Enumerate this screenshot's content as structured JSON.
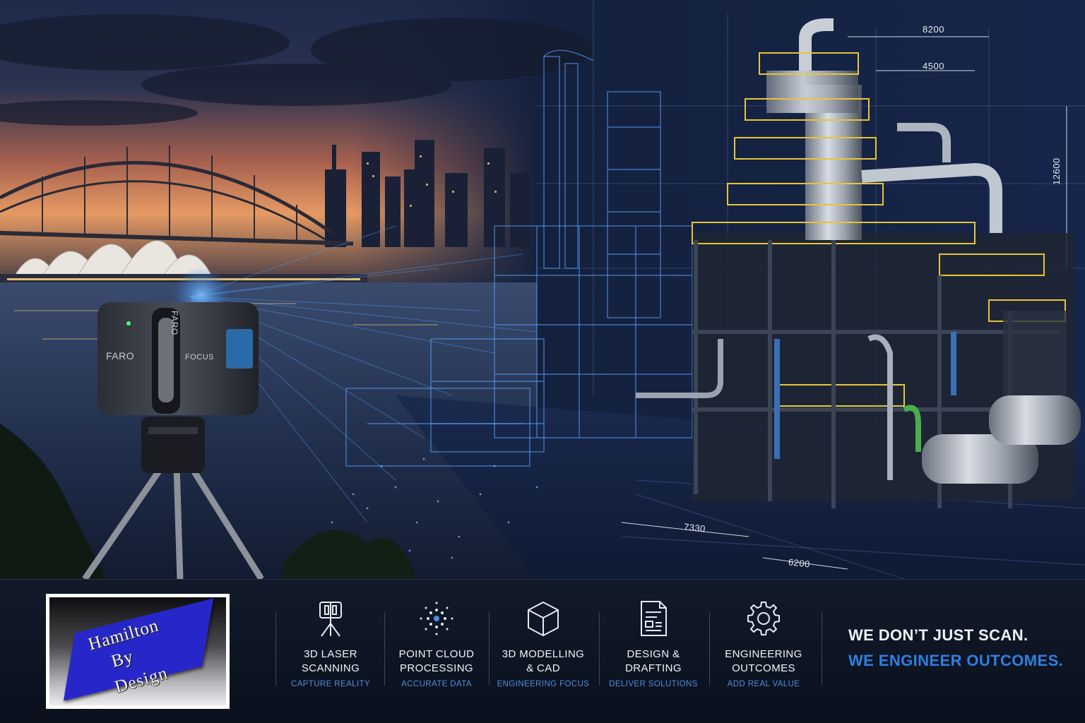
{
  "scene": {
    "dimensions": [
      "8200",
      "4500",
      "12600",
      "7330",
      "6200"
    ],
    "scanner": {
      "brand_side": "FARO",
      "brand_top": "FARO",
      "model": "FOCUS"
    }
  },
  "brand": {
    "logo_words": [
      "Hamilton",
      "By",
      "Design"
    ]
  },
  "services": [
    {
      "icon": "laser-scanner-icon",
      "line1": "3D LASER",
      "line2": "SCANNING",
      "sub": "CAPTURE REALITY"
    },
    {
      "icon": "point-cloud-icon",
      "line1": "POINT CLOUD",
      "line2": "PROCESSING",
      "sub": "ACCURATE DATA"
    },
    {
      "icon": "cube-icon",
      "line1": "3D MODELLING",
      "line2": "& CAD",
      "sub": "ENGINEERING FOCUS"
    },
    {
      "icon": "document-icon",
      "line1": "DESIGN &",
      "line2": "DRAFTING",
      "sub": "DELIVER SOLUTIONS"
    },
    {
      "icon": "gear-icon",
      "line1": "ENGINEERING",
      "line2": "OUTCOMES",
      "sub": "ADD REAL VALUE"
    }
  ],
  "tagline": {
    "line1": "WE DON’T JUST SCAN.",
    "line2": "WE ENGINEER OUTCOMES."
  },
  "colors": {
    "accent_blue": "#2f7fe0",
    "logo_plate": "#2727c9",
    "footer_bg": "#0d1422"
  }
}
